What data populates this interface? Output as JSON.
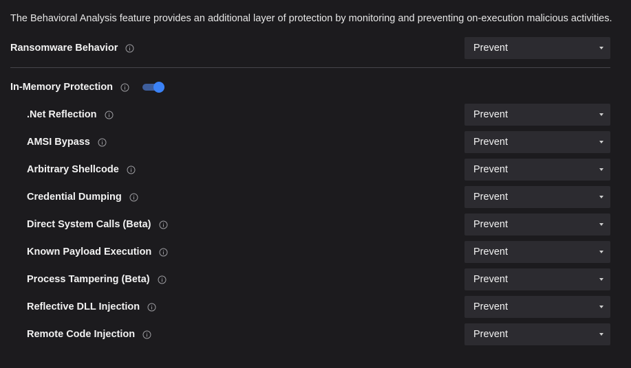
{
  "description": "The Behavioral Analysis feature provides an additional layer of protection by monitoring and preventing on-execution malicious activities.",
  "ransomware": {
    "label": "Ransomware Behavior",
    "value": "Prevent"
  },
  "in_memory": {
    "label": "In-Memory Protection",
    "enabled": true
  },
  "items": [
    {
      "label": ".Net Reflection",
      "value": "Prevent"
    },
    {
      "label": "AMSI Bypass",
      "value": "Prevent"
    },
    {
      "label": "Arbitrary Shellcode",
      "value": "Prevent"
    },
    {
      "label": "Credential Dumping",
      "value": "Prevent"
    },
    {
      "label": "Direct System Calls (Beta)",
      "value": "Prevent"
    },
    {
      "label": "Known Payload Execution",
      "value": "Prevent"
    },
    {
      "label": "Process Tampering (Beta)",
      "value": "Prevent"
    },
    {
      "label": "Reflective DLL Injection",
      "value": "Prevent"
    },
    {
      "label": "Remote Code Injection",
      "value": "Prevent"
    }
  ],
  "colors": {
    "background": "#1c1b1e",
    "select_bg": "#2c2b30",
    "toggle_accent": "#3b82f6"
  }
}
